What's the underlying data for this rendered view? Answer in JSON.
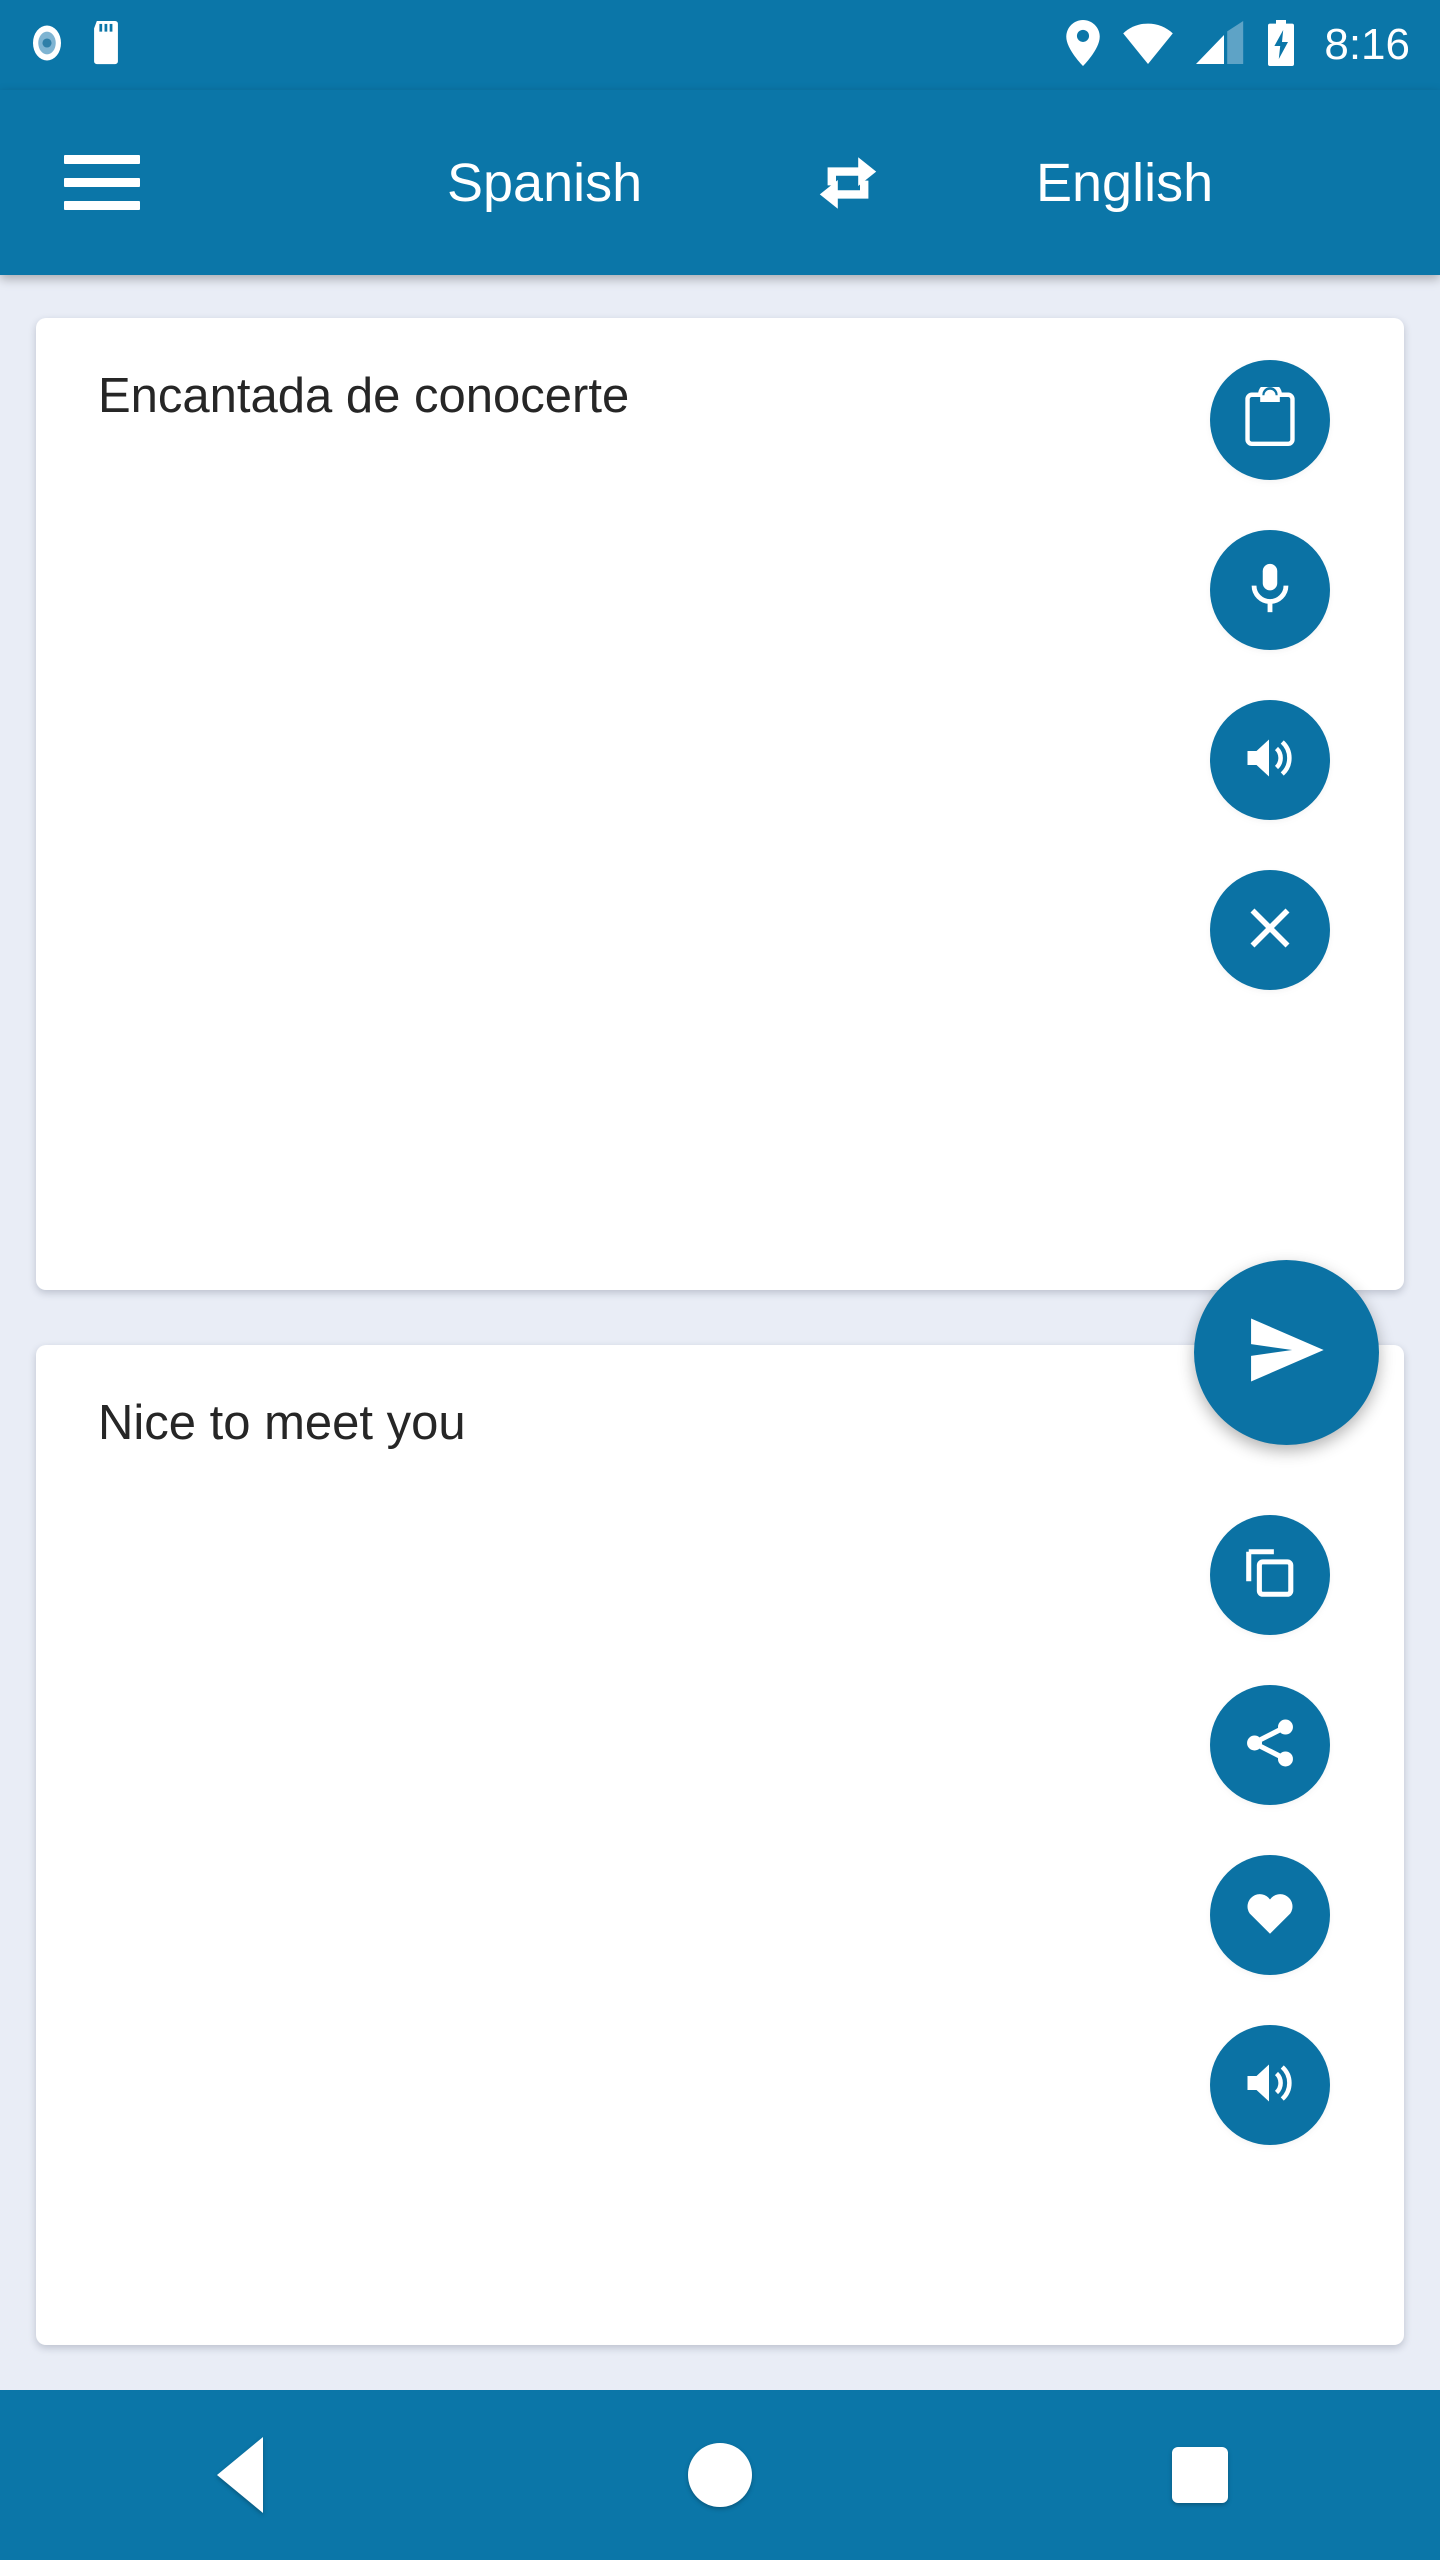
{
  "status_bar": {
    "time": "8:16",
    "icons": [
      "screen-record-icon",
      "sd-card-icon",
      "location-pin-icon",
      "wifi-icon",
      "signal-bars-icon",
      "battery-charging-icon"
    ],
    "background_color": "#0b76a8",
    "foreground_color": "#ffffff"
  },
  "app_bar": {
    "menu_icon": "hamburger-menu-icon",
    "source_language": "Spanish",
    "target_language": "English",
    "swap_icon": "swap-languages-icon",
    "background_color": "#0b76a8"
  },
  "source_card": {
    "text": "Encantada de conocerte",
    "actions": [
      {
        "name": "paste-button",
        "icon": "clipboard-icon"
      },
      {
        "name": "voice-input-button",
        "icon": "microphone-icon"
      },
      {
        "name": "speak-source-button",
        "icon": "speaker-icon"
      },
      {
        "name": "clear-button",
        "icon": "close-icon"
      }
    ]
  },
  "target_card": {
    "text": "Nice to meet you",
    "actions": [
      {
        "name": "copy-button",
        "icon": "copy-icon"
      },
      {
        "name": "share-button",
        "icon": "share-icon"
      },
      {
        "name": "favorite-button",
        "icon": "heart-icon"
      },
      {
        "name": "speak-target-button",
        "icon": "speaker-icon"
      }
    ]
  },
  "translate_fab": {
    "name": "translate-send-button",
    "icon": "send-icon"
  },
  "nav_bar": {
    "buttons": [
      {
        "name": "nav-back-button",
        "icon": "back-triangle-icon"
      },
      {
        "name": "nav-home-button",
        "icon": "home-circle-icon"
      },
      {
        "name": "nav-recents-button",
        "icon": "recents-square-icon"
      }
    ],
    "background_color": "#0b76a8"
  },
  "theme": {
    "primary": "#0b76a8",
    "button": "#0b72a4",
    "page_background": "#e9edf6",
    "card_background": "#ffffff",
    "text_color": "#262626"
  }
}
